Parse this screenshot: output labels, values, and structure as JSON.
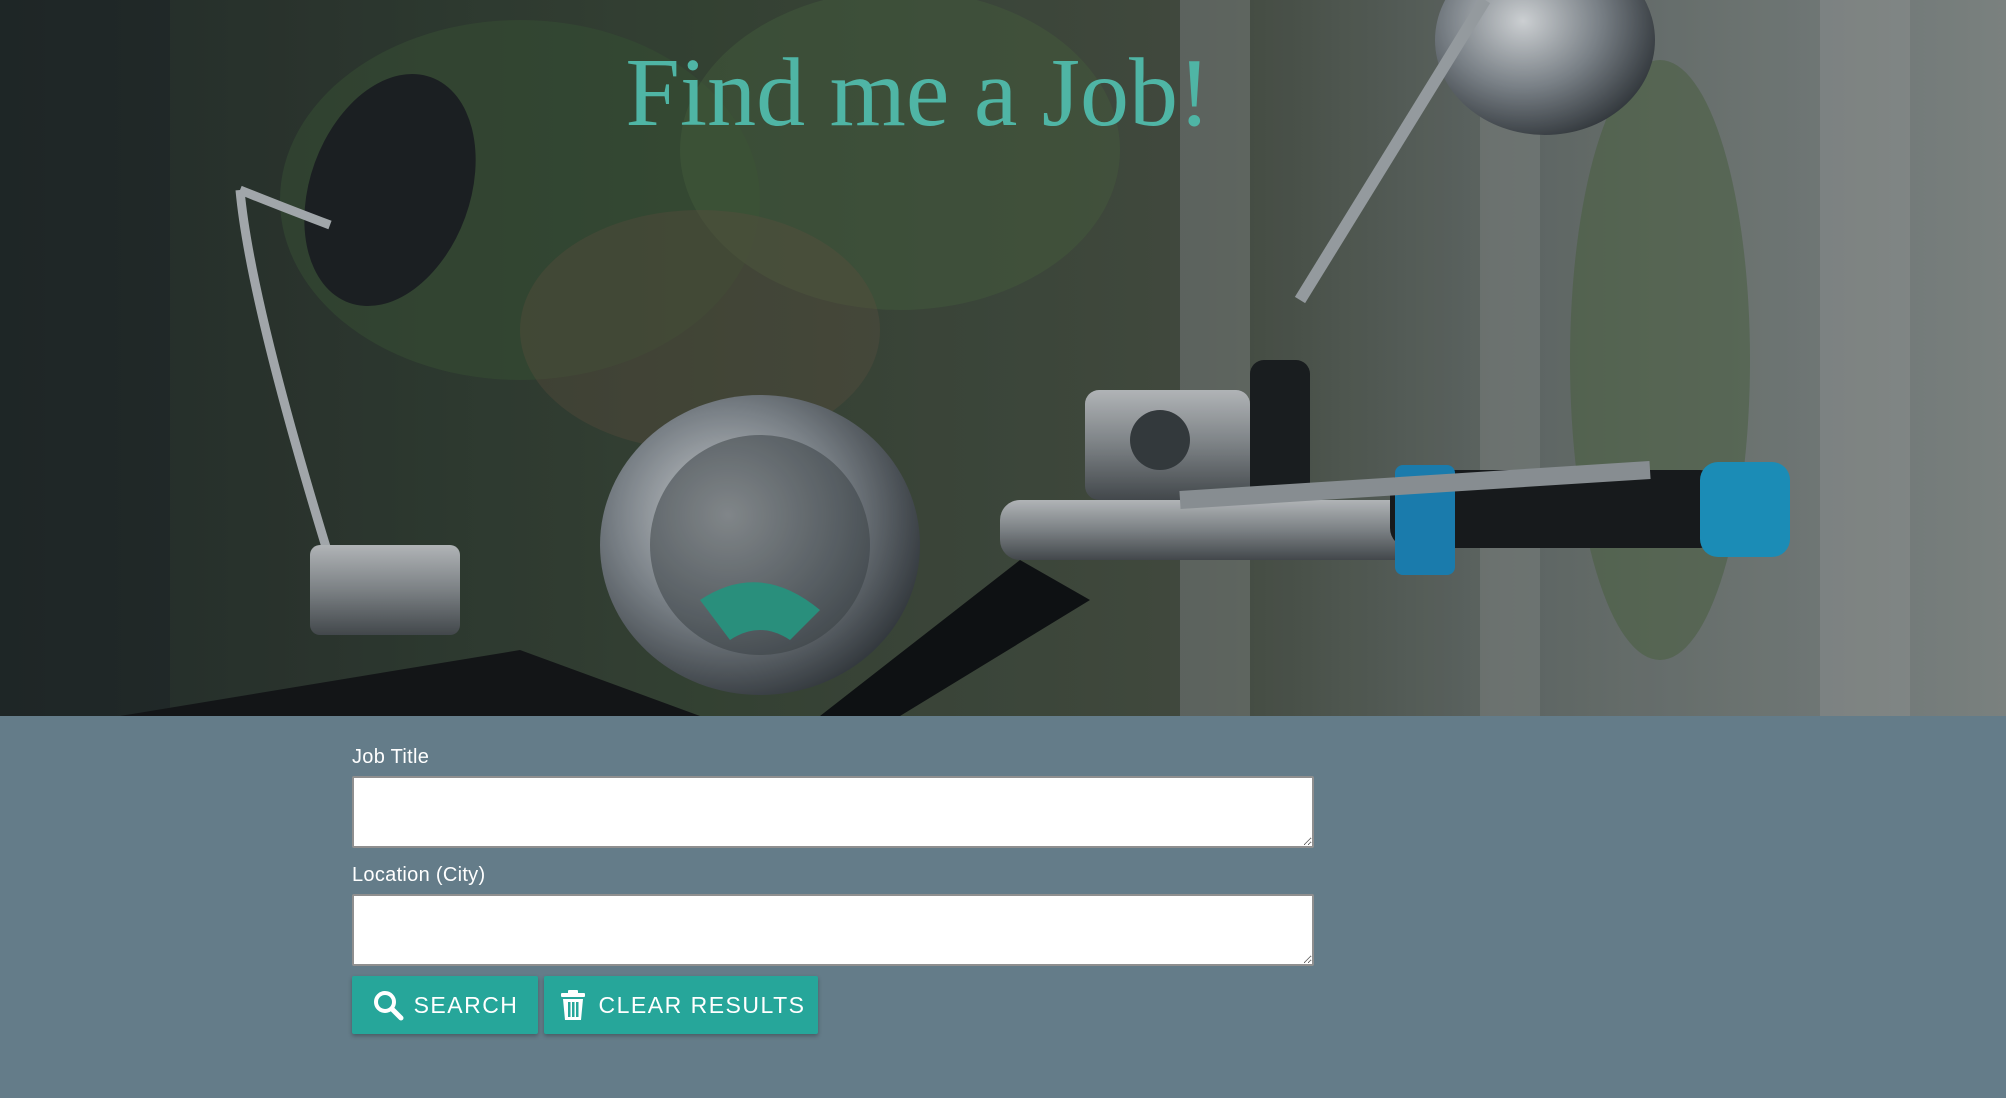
{
  "hero": {
    "title": "Find me a Job!"
  },
  "form": {
    "job_title_label": "Job Title",
    "job_title_value": "",
    "location_label": "Location (City)",
    "location_value": "",
    "search_button": {
      "label": "SEARCH",
      "icon": "search-icon"
    },
    "clear_button": {
      "label": "CLEAR RESULTS",
      "icon": "trash-icon"
    }
  },
  "colors": {
    "title_teal": "#4fb5a5",
    "form_background": "#647c89",
    "button_teal": "#26a69a"
  }
}
